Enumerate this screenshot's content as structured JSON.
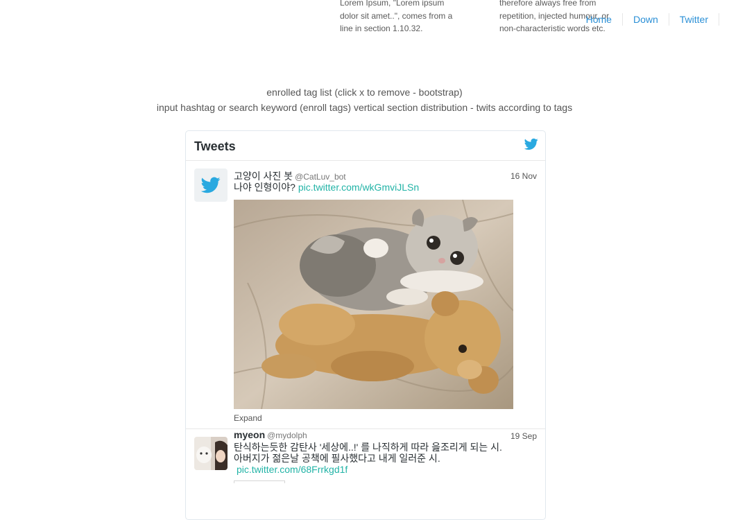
{
  "background_lorem": {
    "left": [
      "Lorem Ipsum, \"Lorem ipsum",
      "dolor sit amet..\", comes from a",
      "line in section 1.10.32."
    ],
    "right": [
      "therefore always free from",
      "repetition, injected humour, or",
      "non-characteristic words etc."
    ]
  },
  "nav": {
    "home": "Home",
    "down": "Down",
    "twitter": "Twitter"
  },
  "description": {
    "line1": "enrolled tag list (click x to remove - bootstrap)",
    "line2": "input hashtag or search keyword (enroll tags) vertical section distribution - twits according to tags"
  },
  "widget": {
    "title": "Tweets",
    "tweets": [
      {
        "name": "고양이 사진 봇",
        "screen_name": "@CatLuv_bot",
        "date": "16 Nov",
        "text": "나야 인형이야?",
        "link": "pic.twitter.com/wkGmviJLSn",
        "expand": "Expand"
      },
      {
        "name": "myeon",
        "screen_name": "@mydolph",
        "date": "19 Sep",
        "text_line1": "탄식하는듯한 감탄사 '세상에..!' 를 나직하게 따라 읊조리게 되는 시.",
        "text_line2": "아버지가 젊은날 공책에 필사했다고 내게 일러준 시.",
        "link": "pic.twitter.com/68Frrkgd1f"
      }
    ]
  },
  "colors": {
    "link_blue": "#2a8fd6",
    "tweet_link": "#21b3a6",
    "twitter_blue": "#2aa9e0"
  },
  "icons": {
    "widget_bird": "twitter-bird-icon",
    "avatar_bird": "twitter-bird-icon"
  }
}
